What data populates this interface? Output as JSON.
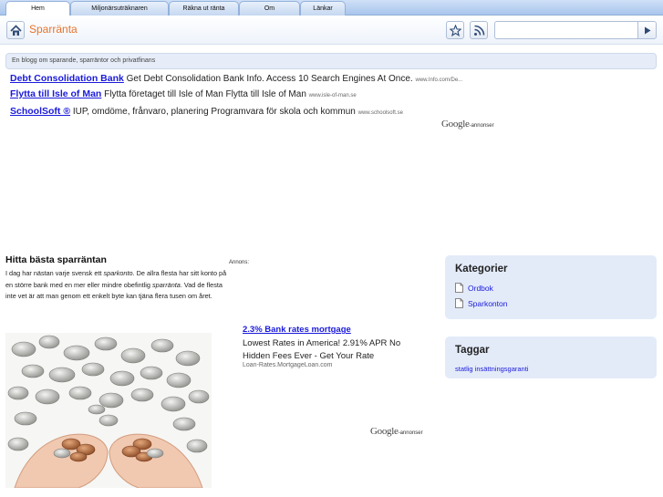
{
  "nav": {
    "tabs": [
      {
        "label": "Hem"
      },
      {
        "label": "Miljonärsuträknaren"
      },
      {
        "label": "Räkna ut ränta"
      },
      {
        "label": "Om"
      },
      {
        "label": "Länkar"
      }
    ]
  },
  "header": {
    "site_title": "Sparränta",
    "search_value": ""
  },
  "tagline": "En blogg om sparande, sparräntor och privatfinans",
  "top_ads": [
    {
      "title": "Debt Consolidation Bank",
      "text": "Get Debt Consolidation Bank Info. Access 10 Search Engines At Once.",
      "url": "www.Info.com/De..."
    },
    {
      "title": "Flytta till Isle of Man",
      "text": "Flytta företaget till Isle of Man Flytta till Isle of Man",
      "url": "www.isle-of-man.se"
    },
    {
      "title": "SchoolSoft ®",
      "text": "IUP, omdöme, frånvaro, planering Programvara för skola och kommun",
      "url": "www.schoolsoft.se"
    }
  ],
  "google_ads_label": {
    "logo": "Google",
    "suffix": "-annonser"
  },
  "post": {
    "title": "Hitta bästa sparräntan",
    "body_1": "I dag har nästan varje svensk ett ",
    "body_em_1": "sparkonto",
    "body_2": ". De allra flesta har sitt konto på en större bank med en mer eller mindre obefintlig ",
    "body_em_2": "sparränta",
    "body_3": ". Vad de flesta inte vet är att man genom ett enkelt byte kan tjäna flera tusen om året."
  },
  "annons_label": "Annons:",
  "side_ad": {
    "title": "2.3% Bank rates mortgage",
    "text": "Lowest Rates in America! 2.91% APR No Hidden Fees Ever - Get Your Rate",
    "url": "Loan-Rates.MortgageLoan.com"
  },
  "sidebar": {
    "categories_title": "Kategorier",
    "categories": [
      {
        "label": "Ordbok"
      },
      {
        "label": "Sparkonton"
      }
    ],
    "tags_title": "Taggar",
    "tags": [
      {
        "label": "statlig insättningsgaranti"
      }
    ]
  },
  "colors": {
    "accent": "#e8742c",
    "link": "#1a1adb",
    "sidebar_bg": "#e3ebf9"
  },
  "icons": [
    "home-icon",
    "star-icon",
    "rss-icon",
    "arrow-right-icon",
    "document-icon"
  ]
}
